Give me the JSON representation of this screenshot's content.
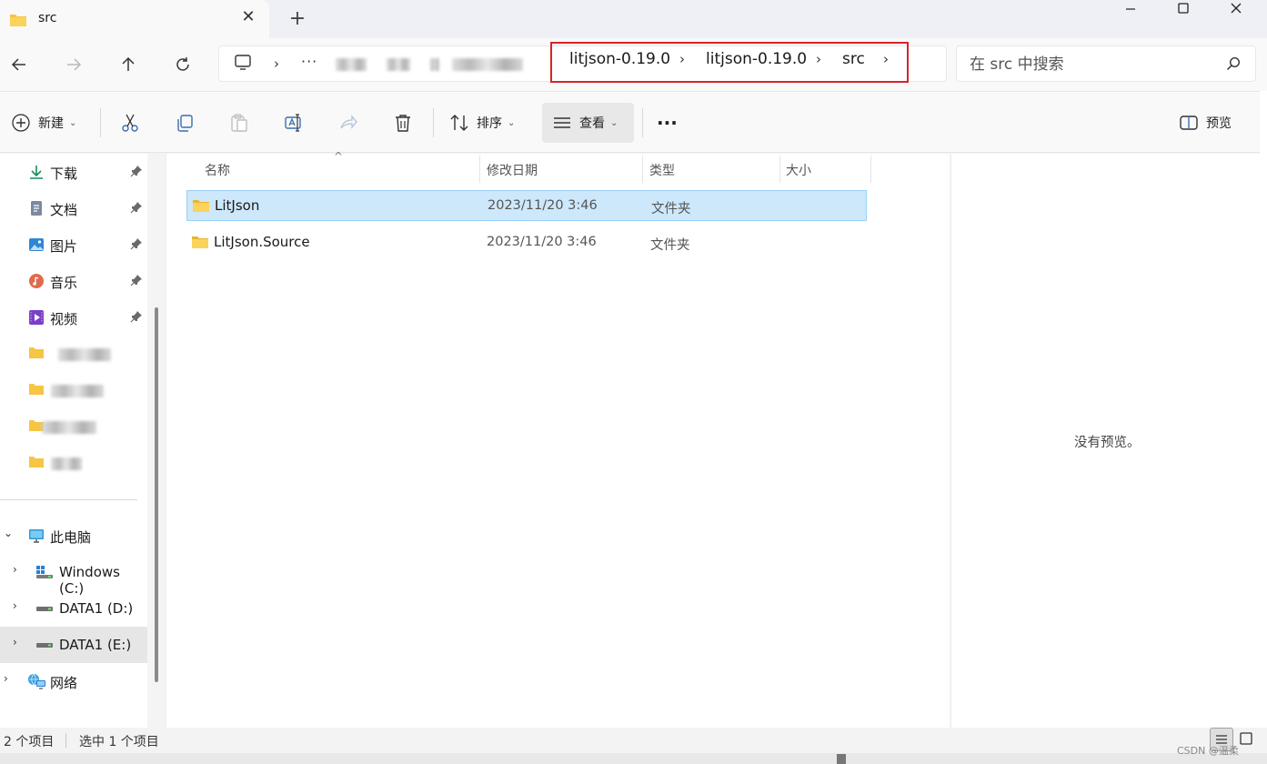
{
  "window": {
    "tab_title": "src",
    "tab_close_glyph": "✕",
    "new_tab_glyph": "+",
    "minimize_glyph": "—",
    "maximize_glyph": "☐",
    "close_glyph": "✕"
  },
  "nav": {
    "back_icon": "arrow-left-icon",
    "forward_icon": "arrow-right-icon",
    "up_icon": "arrow-up-icon",
    "refresh_icon": "refresh-icon",
    "chevron": "›",
    "ellipsis": "···",
    "breadcrumbs": [
      "litjson-0.19.0",
      "litjson-0.19.0",
      "src"
    ],
    "search_placeholder": "在 src 中搜索"
  },
  "toolbar": {
    "new_label": "新建",
    "sort_label": "排序",
    "view_label": "查看",
    "more_label": "···",
    "preview_label": "预览",
    "dropdown_glyph": "⌄"
  },
  "sidebar": {
    "quick_access": [
      {
        "label": "下载",
        "icon": "download-icon"
      },
      {
        "label": "文档",
        "icon": "document-icon"
      },
      {
        "label": "图片",
        "icon": "pictures-icon"
      },
      {
        "label": "音乐",
        "icon": "music-icon"
      },
      {
        "label": "视频",
        "icon": "video-icon"
      }
    ],
    "this_pc": "此电脑",
    "drives": [
      {
        "label": "Windows (C:)",
        "icon": "windows-drive-icon"
      },
      {
        "label": "DATA1 (D:)",
        "icon": "drive-icon"
      },
      {
        "label": "DATA1 (E:)",
        "icon": "drive-icon"
      }
    ],
    "network": "网络",
    "expand_glyph": "›",
    "collapse_glyph": "⌄"
  },
  "columns": {
    "name": "名称",
    "modified": "修改日期",
    "type": "类型",
    "size": "大小",
    "sort_glyph": "^"
  },
  "files": [
    {
      "name": "LitJson",
      "modified": "2023/11/20 3:46",
      "type": "文件夹",
      "selected": true
    },
    {
      "name": "LitJson.Source",
      "modified": "2023/11/20 3:46",
      "type": "文件夹",
      "selected": false
    }
  ],
  "preview": {
    "message": "没有预览。"
  },
  "status": {
    "item_count": "2 个项目",
    "selected_count": "选中 1 个项目"
  },
  "watermark": "CSDN @温柔"
}
